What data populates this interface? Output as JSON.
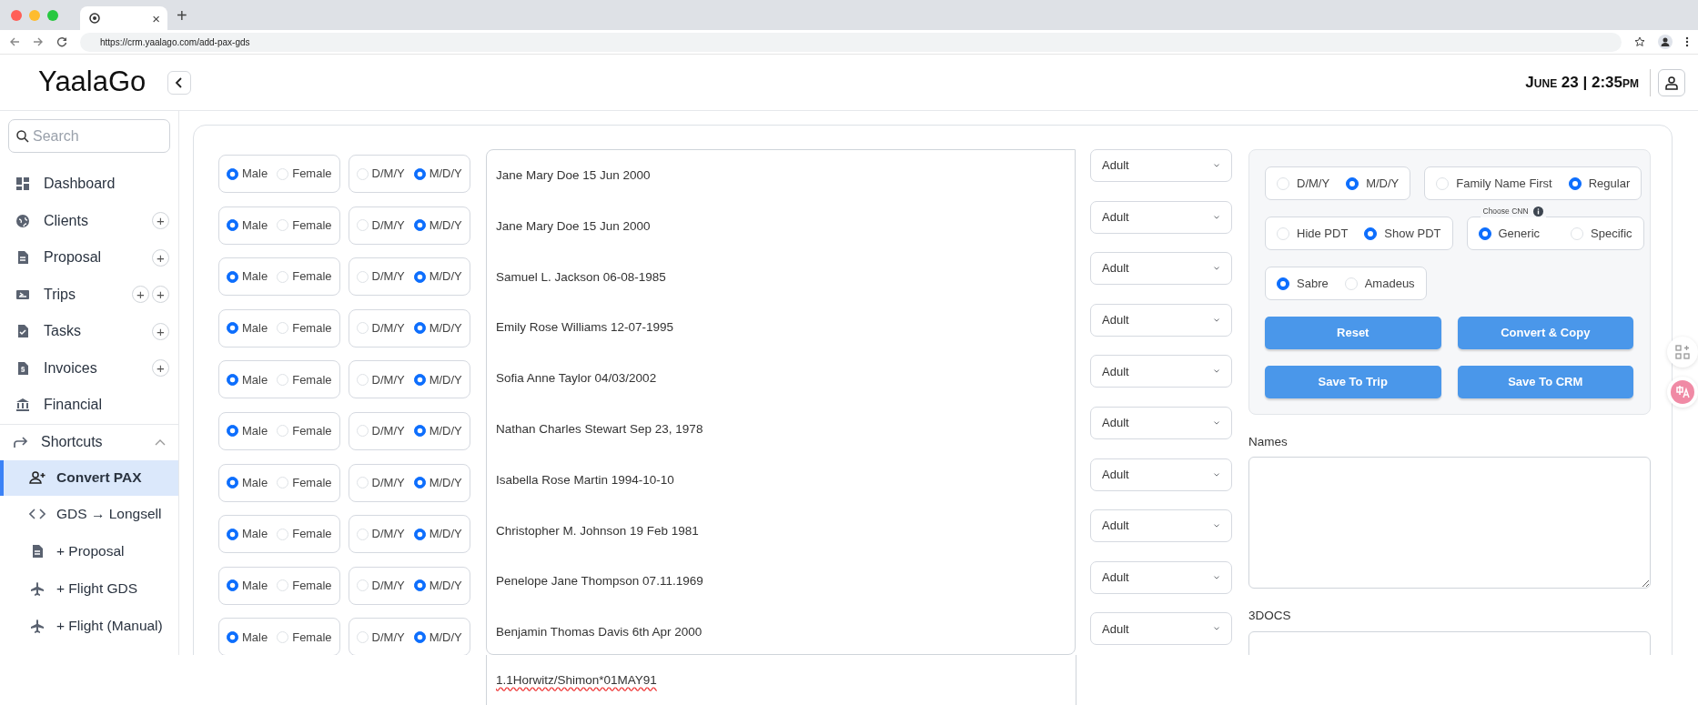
{
  "browser": {
    "close_tab": "×",
    "new_tab": "+",
    "url": "https://crm.yaalago.com/add-pax-gds"
  },
  "header": {
    "logo": "YaalaGo",
    "datetime": "June 23 | 2:35pm"
  },
  "sidebar": {
    "search": {
      "placeholder": "Search"
    },
    "items": [
      {
        "label": "Dashboard"
      },
      {
        "label": "Clients",
        "actions": [
          "+"
        ]
      },
      {
        "label": "Proposal",
        "actions": [
          "+"
        ]
      },
      {
        "label": "Trips",
        "actions": [
          "+",
          "+"
        ]
      },
      {
        "label": "Tasks",
        "actions": [
          "+"
        ]
      },
      {
        "label": "Invoices",
        "actions": [
          "+"
        ]
      },
      {
        "label": "Financial"
      }
    ],
    "shortcuts": {
      "label": "Shortcuts",
      "expanded": true,
      "items": [
        {
          "label": "Convert PAX",
          "selected": true
        },
        {
          "label": "GDS → Longsell",
          "selected": false
        },
        {
          "label": "+ Proposal",
          "selected": false
        },
        {
          "label": "+ Flight GDS",
          "selected": false
        },
        {
          "label": "+ Flight (Manual)",
          "selected": false
        }
      ]
    }
  },
  "passengers": [
    {
      "gender": [
        {
          "label": "Male",
          "selected": true
        },
        {
          "label": "Female",
          "selected": false
        }
      ],
      "date_format": [
        {
          "label": "D/M/Y",
          "selected": false
        },
        {
          "label": "M/D/Y",
          "selected": true
        }
      ],
      "type": "Adult"
    },
    {
      "gender": [
        {
          "label": "Male",
          "selected": true
        },
        {
          "label": "Female",
          "selected": false
        }
      ],
      "date_format": [
        {
          "label": "D/M/Y",
          "selected": false
        },
        {
          "label": "M/D/Y",
          "selected": true
        }
      ],
      "type": "Adult"
    },
    {
      "gender": [
        {
          "label": "Male",
          "selected": true
        },
        {
          "label": "Female",
          "selected": false
        }
      ],
      "date_format": [
        {
          "label": "D/M/Y",
          "selected": false
        },
        {
          "label": "M/D/Y",
          "selected": true
        }
      ],
      "type": "Adult"
    },
    {
      "gender": [
        {
          "label": "Male",
          "selected": true
        },
        {
          "label": "Female",
          "selected": false
        }
      ],
      "date_format": [
        {
          "label": "D/M/Y",
          "selected": false
        },
        {
          "label": "M/D/Y",
          "selected": true
        }
      ],
      "type": "Adult"
    },
    {
      "gender": [
        {
          "label": "Male",
          "selected": true
        },
        {
          "label": "Female",
          "selected": false
        }
      ],
      "date_format": [
        {
          "label": "D/M/Y",
          "selected": false
        },
        {
          "label": "M/D/Y",
          "selected": true
        }
      ],
      "type": "Adult"
    },
    {
      "gender": [
        {
          "label": "Male",
          "selected": true
        },
        {
          "label": "Female",
          "selected": false
        }
      ],
      "date_format": [
        {
          "label": "D/M/Y",
          "selected": false
        },
        {
          "label": "M/D/Y",
          "selected": true
        }
      ],
      "type": "Adult"
    },
    {
      "gender": [
        {
          "label": "Male",
          "selected": true
        },
        {
          "label": "Female",
          "selected": false
        }
      ],
      "date_format": [
        {
          "label": "D/M/Y",
          "selected": false
        },
        {
          "label": "M/D/Y",
          "selected": true
        }
      ],
      "type": "Adult"
    },
    {
      "gender": [
        {
          "label": "Male",
          "selected": true
        },
        {
          "label": "Female",
          "selected": false
        }
      ],
      "date_format": [
        {
          "label": "D/M/Y",
          "selected": false
        },
        {
          "label": "M/D/Y",
          "selected": true
        }
      ],
      "type": "Adult"
    },
    {
      "gender": [
        {
          "label": "Male",
          "selected": true
        },
        {
          "label": "Female",
          "selected": false
        }
      ],
      "date_format": [
        {
          "label": "D/M/Y",
          "selected": false
        },
        {
          "label": "M/D/Y",
          "selected": true
        }
      ],
      "type": "Adult"
    },
    {
      "gender": [
        {
          "label": "Male",
          "selected": true
        },
        {
          "label": "Female",
          "selected": false
        }
      ],
      "date_format": [
        {
          "label": "D/M/Y",
          "selected": false
        },
        {
          "label": "M/D/Y",
          "selected": true
        }
      ],
      "type": "Adult"
    }
  ],
  "input_lines": [
    {
      "text": "Jane Mary Doe 15 Jun 2000",
      "misspelled": false
    },
    {
      "text": "Jane Mary Doe 15 Jun 2000",
      "misspelled": false
    },
    {
      "text": "Samuel L. Jackson 06-08-1985",
      "misspelled": false
    },
    {
      "text": "Emily Rose Williams 12-07-1995",
      "misspelled": false
    },
    {
      "text": "Sofia Anne Taylor 04/03/2002",
      "misspelled": false
    },
    {
      "text": "Nathan Charles Stewart Sep 23, 1978",
      "misspelled": false
    },
    {
      "text": "Isabella Rose Martin 1994-10-10",
      "misspelled": false
    },
    {
      "text": "Christopher M. Johnson 19 Feb 1981",
      "misspelled": false
    },
    {
      "text": "Penelope Jane Thompson 07.11.1969",
      "misspelled": false
    },
    {
      "text": "Benjamin Thomas Davis 6th Apr 2000",
      "misspelled": false
    },
    {
      "text": "1.1Horwitz/Shimon*01MAY91",
      "misspelled": true
    }
  ],
  "settings": {
    "option_rows": [
      [
        {
          "options": [
            {
              "label": "D/M/Y",
              "selected": false
            },
            {
              "label": "M/D/Y",
              "selected": true
            }
          ]
        },
        {
          "options": [
            {
              "label": "Family Name First",
              "selected": false
            },
            {
              "label": "Regular",
              "selected": true
            }
          ]
        }
      ],
      [
        {
          "options": [
            {
              "label": "Hide PDT",
              "selected": false
            },
            {
              "label": "Show PDT",
              "selected": true
            }
          ]
        },
        {
          "legend": "Choose CNN",
          "options": [
            {
              "label": "Generic",
              "selected": true
            },
            {
              "label": "Specific",
              "selected": false
            }
          ]
        }
      ],
      [
        {
          "options": [
            {
              "label": "Sabre",
              "selected": true
            },
            {
              "label": "Amadeus",
              "selected": false
            }
          ]
        }
      ]
    ],
    "buttons": [
      "Reset",
      "Convert & Copy",
      "Save To Trip",
      "Save To CRM"
    ]
  },
  "outputs": [
    {
      "label": "Names"
    },
    {
      "label": "3DOCS"
    }
  ]
}
